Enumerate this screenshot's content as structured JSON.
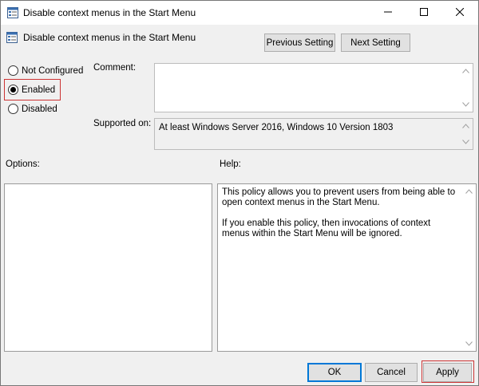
{
  "window": {
    "title": "Disable context menus in the Start Menu",
    "minimize_icon": "minimize-icon",
    "maximize_icon": "maximize-icon",
    "close_icon": "close-icon"
  },
  "header": {
    "policy_name": "Disable context menus in the Start Menu",
    "previous_label": "Previous Setting",
    "next_label": "Next Setting"
  },
  "state": {
    "options": [
      {
        "label": "Not Configured",
        "checked": false
      },
      {
        "label": "Enabled",
        "checked": true
      },
      {
        "label": "Disabled",
        "checked": false
      }
    ]
  },
  "comment": {
    "label": "Comment:",
    "value": ""
  },
  "supported": {
    "label": "Supported on:",
    "value": "At least Windows Server 2016, Windows 10 Version 1803"
  },
  "options_pane": {
    "label": "Options:"
  },
  "help_pane": {
    "label": "Help:",
    "paragraph1": "This policy allows you to prevent users from being able to open context menus in the Start Menu.",
    "paragraph2": "If you enable this policy, then invocations of context menus within the Start Menu will be ignored."
  },
  "footer": {
    "ok_label": "OK",
    "cancel_label": "Cancel",
    "apply_label": "Apply"
  },
  "colors": {
    "highlight": "#cc3333",
    "focus_border": "#0078d7"
  }
}
